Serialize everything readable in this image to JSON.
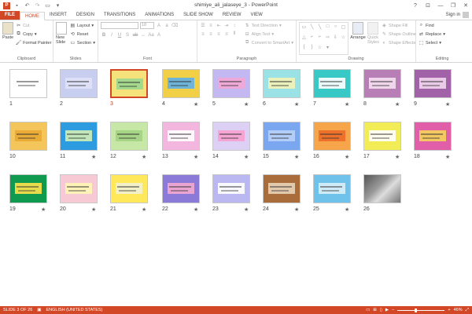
{
  "window": {
    "title": "shimiye_ali_jalaseye_3 - PowerPoint",
    "help": "?",
    "minimize": "—",
    "restore": "❐",
    "close": "✕"
  },
  "tabs": [
    "FILE",
    "HOME",
    "INSERT",
    "DESIGN",
    "TRANSITIONS",
    "ANIMATIONS",
    "SLIDE SHOW",
    "REVIEW",
    "VIEW"
  ],
  "signin": "Sign in",
  "ribbon": {
    "clipboard": {
      "label": "Clipboard",
      "paste": "Paste",
      "cut": "Cut",
      "copy": "Copy",
      "format_painter": "Format Painter"
    },
    "slides": {
      "label": "Slides",
      "new_slide": "New Slide",
      "layout": "Layout",
      "reset": "Reset",
      "section": "Section"
    },
    "font": {
      "label": "Font",
      "size": "18"
    },
    "paragraph": {
      "label": "Paragraph",
      "text_direction": "Text Direction",
      "align_text": "Align Text",
      "convert": "Convert to SmartArt"
    },
    "drawing": {
      "label": "Drawing",
      "arrange": "Arrange",
      "quick_styles": "Quick Styles",
      "shape_fill": "Shape Fill",
      "shape_outline": "Shape Outline",
      "shape_effects": "Shape Effects"
    },
    "editing": {
      "label": "Editing",
      "find": "Find",
      "replace": "Replace",
      "select": "Select"
    }
  },
  "slides": [
    {
      "n": "1",
      "bg": "#ffffff",
      "accent": "#ffffff",
      "star": false
    },
    {
      "n": "2",
      "bg": "#c8cef0",
      "accent": "#dfe2f7",
      "star": false
    },
    {
      "n": "3",
      "bg": "#f5e27a",
      "accent": "#9bd88f",
      "star": false,
      "selected": true
    },
    {
      "n": "4",
      "bg": "#f1d048",
      "accent": "#5fb0e8",
      "star": true
    },
    {
      "n": "5",
      "bg": "#c4b8f2",
      "accent": "#f4a7d6",
      "star": true
    },
    {
      "n": "6",
      "bg": "#9be2e6",
      "accent": "#f3f3b5",
      "star": true
    },
    {
      "n": "7",
      "bg": "#38c8c6",
      "accent": "#ffffff",
      "star": true
    },
    {
      "n": "8",
      "bg": "#b77fb6",
      "accent": "#f6e0f1",
      "star": true
    },
    {
      "n": "9",
      "bg": "#a262a7",
      "accent": "#f2d7ee",
      "star": true
    },
    {
      "n": "10",
      "bg": "#f3c55b",
      "accent": "#eaa933",
      "star": false
    },
    {
      "n": "11",
      "bg": "#2d9be0",
      "accent": "#d2eeb6",
      "star": true
    },
    {
      "n": "12",
      "bg": "#c6e7a6",
      "accent": "#a2d383",
      "star": true
    },
    {
      "n": "13",
      "bg": "#f2b6df",
      "accent": "#ffffff",
      "star": true
    },
    {
      "n": "14",
      "bg": "#dcd0f5",
      "accent": "#f6a0d0",
      "star": true
    },
    {
      "n": "15",
      "bg": "#7aa7f0",
      "accent": "#b8d3f8",
      "star": true
    },
    {
      "n": "16",
      "bg": "#f7a54b",
      "accent": "#eb6a28",
      "star": true
    },
    {
      "n": "17",
      "bg": "#f2ec57",
      "accent": "#ffffff",
      "star": true
    },
    {
      "n": "18",
      "bg": "#e15ea8",
      "accent": "#f5d35a",
      "star": true
    },
    {
      "n": "19",
      "bg": "#0f9a50",
      "accent": "#ffe14a",
      "star": true
    },
    {
      "n": "20",
      "bg": "#f7c9d5",
      "accent": "#fff6b5",
      "star": true
    },
    {
      "n": "21",
      "bg": "#ffe85a",
      "accent": "#f1f1d3",
      "star": true
    },
    {
      "n": "22",
      "bg": "#8b7ad8",
      "accent": "#f3a8d0",
      "star": true
    },
    {
      "n": "23",
      "bg": "#bbb7f0",
      "accent": "#ffffff",
      "star": true
    },
    {
      "n": "24",
      "bg": "#a86d3b",
      "accent": "#e9d3b9",
      "star": true
    },
    {
      "n": "25",
      "bg": "#6fc3ea",
      "accent": "#d8f0f8",
      "star": true
    },
    {
      "n": "26",
      "bg": "#8a8a8a",
      "accent": "#d4d4d4",
      "star": false,
      "photo": true
    }
  ],
  "status": {
    "slide_of": "SLIDE 3 OF 26",
    "language": "ENGLISH (UNITED STATES)",
    "zoom": "46%"
  }
}
